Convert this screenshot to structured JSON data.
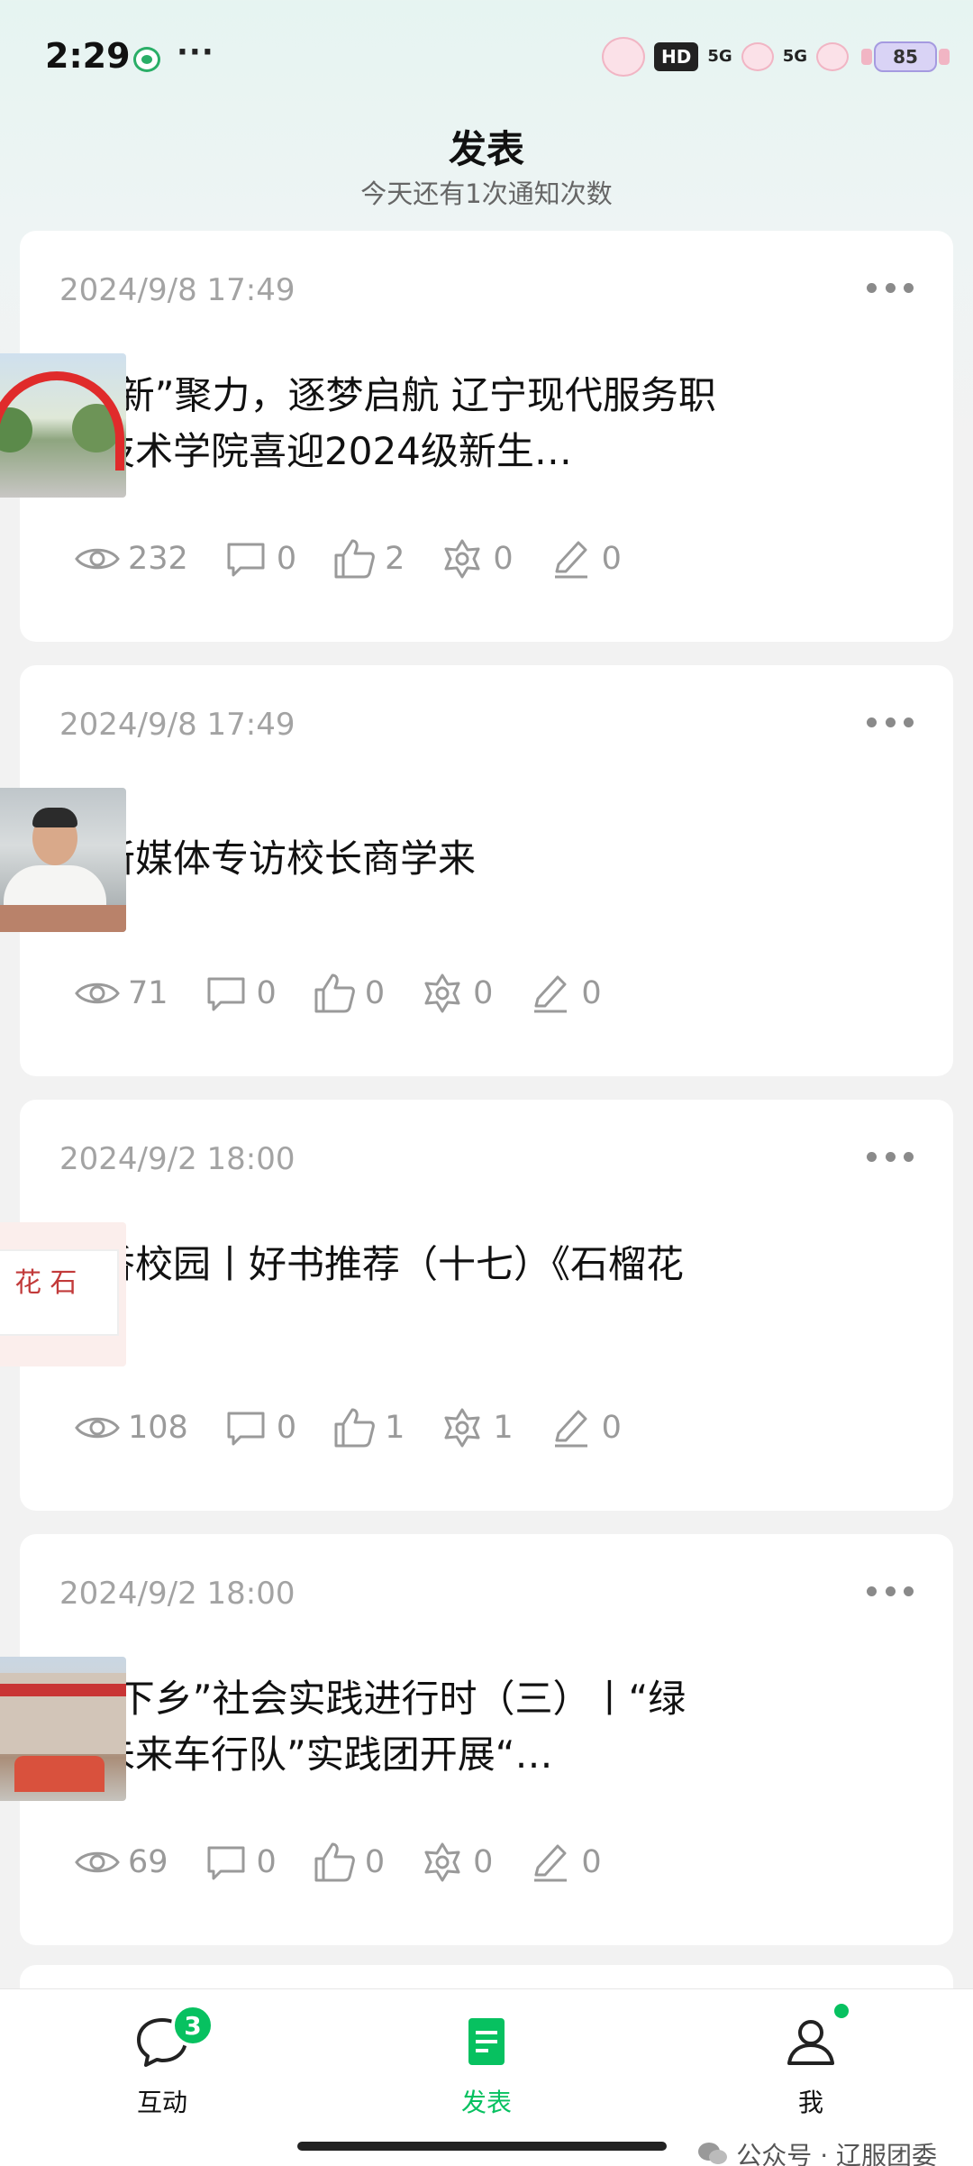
{
  "status_bar": {
    "time": "2:29",
    "dots": "···",
    "hd": "HD",
    "net1": "5G",
    "net2": "5G",
    "battery": "85"
  },
  "header": {
    "title": "发表",
    "subtitle": "今天还有1次通知次数"
  },
  "posts": [
    {
      "date": "2024/9/8 17:49",
      "title": "凝“新”聚力，逐梦启航 辽宁现代服务职业技术学院喜迎2024级新生…",
      "views": "232",
      "comments": "0",
      "likes": "2",
      "shares": "0",
      "edits": "0"
    },
    {
      "date": "2024/9/8 17:49",
      "title": "校新媒体专访校长商学来",
      "views": "71",
      "comments": "0",
      "likes": "0",
      "shares": "0",
      "edits": "0"
    },
    {
      "date": "2024/9/2 18:00",
      "title": "书香校园丨好书推荐（十七）《石榴花开》",
      "views": "108",
      "comments": "0",
      "likes": "1",
      "shares": "1",
      "edits": "0"
    },
    {
      "date": "2024/9/2 18:00",
      "title": "“三下乡”社会实践进行时（三）丨“绿动未来车行队”实践团开展“…",
      "views": "69",
      "comments": "0",
      "likes": "0",
      "shares": "0",
      "edits": "0"
    }
  ],
  "nav": {
    "interact": "互动",
    "interact_badge": "3",
    "publish": "发表",
    "me": "我"
  },
  "watermark": "公众号 · 辽服团委",
  "colors": {
    "accent": "#07c160",
    "muted": "#9a9a9a"
  }
}
